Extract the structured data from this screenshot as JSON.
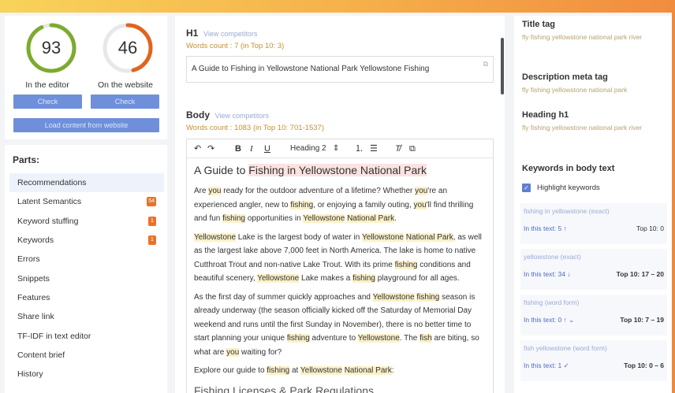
{
  "gauges": [
    {
      "value": "93",
      "label": "In the editor",
      "button": "Check",
      "color": "#7cab2f",
      "fraction": 0.93
    },
    {
      "value": "46",
      "label": "On the website",
      "button": "Check",
      "color": "#e0651f",
      "fraction": 0.46
    }
  ],
  "load_button": "Load content from website",
  "parts": {
    "title": "Parts:",
    "items": [
      {
        "label": "Recommendations",
        "badge": ""
      },
      {
        "label": "Latent Semantics",
        "badge": "54"
      },
      {
        "label": "Keyword stuffing",
        "badge": "1"
      },
      {
        "label": "Keywords",
        "badge": "1"
      },
      {
        "label": "Errors",
        "badge": ""
      },
      {
        "label": "Snippets",
        "badge": ""
      },
      {
        "label": "Features",
        "badge": ""
      },
      {
        "label": "Share link",
        "badge": ""
      },
      {
        "label": "TF-IDF in text editor",
        "badge": ""
      },
      {
        "label": "Content brief",
        "badge": ""
      },
      {
        "label": "History",
        "badge": ""
      }
    ]
  },
  "h1": {
    "title": "H1",
    "compare": "View competitors",
    "wordcount": "Words count : 7 (in Top 10: 3)",
    "value": "A Guide to Fishing in Yellowstone National Park Yellowstone Fishing"
  },
  "body": {
    "title": "Body",
    "compare": "View competitors",
    "wordcount": "Words count : 1083 (in Top 10: 701-1537)",
    "heading_select": "Heading 2",
    "heading": "A Guide to Fishing in Yellowstone National Park",
    "p1": "Are you ready for the outdoor adventure of a lifetime? Whether you're an experienced angler, new to fishing, or enjoying a family outing, you'll find thrilling and fun fishing opportunities in Yellowstone National Park.",
    "p2": "Yellowstone Lake is the largest body of water in Yellowstone National Park, as well as the largest lake above 7,000 feet in North America. The lake is home to native Cutthroat Trout and non-native Lake Trout. With its prime fishing conditions and beautiful scenery, Yellowstone Lake makes a fishing playground for all ages.",
    "p3": "As the first day of summer quickly approaches and Yellowstone fishing season is already underway (the season officially kicked off the Saturday of Memorial Day weekend and runs until the first Sunday in November), there is no better time to start planning your unique fishing adventure to Yellowstone. The fish are biting, so what are you waiting for?",
    "p4": "Explore our guide to fishing at Yellowstone National Park:",
    "h3": "Fishing Licenses & Park Regulations"
  },
  "right": {
    "title_tag": "Title tag",
    "title_tag_words": "fly   fishing   yellowstone   national   park   river",
    "meta_tag": "Description meta tag",
    "meta_tag_words": "fly   fishing   yellowstone   national   park",
    "heading_h1": "Heading h1",
    "heading_h1_words": "fly   fishing   yellowstone   national   park   river",
    "kw_body": "Keywords in body text",
    "highlight": "Highlight keywords",
    "cards": [
      {
        "name": "fishing in yellowstone (exact)",
        "left": "In this text: 5 ↑",
        "right": "Top 10: 0"
      },
      {
        "name": "yellowstone (exact)",
        "left": "In this text: 34 ↓",
        "right": "Top 10: 17 – 20"
      },
      {
        "name": "fishing (word form)",
        "left": "In this text: 0 ↑   ⌄",
        "right": "Top 10: 7 – 19"
      },
      {
        "name": "fish yellowstone (word form)",
        "left": "In this text: 1 ✓",
        "right": "Top 10: 0 – 6"
      }
    ]
  }
}
